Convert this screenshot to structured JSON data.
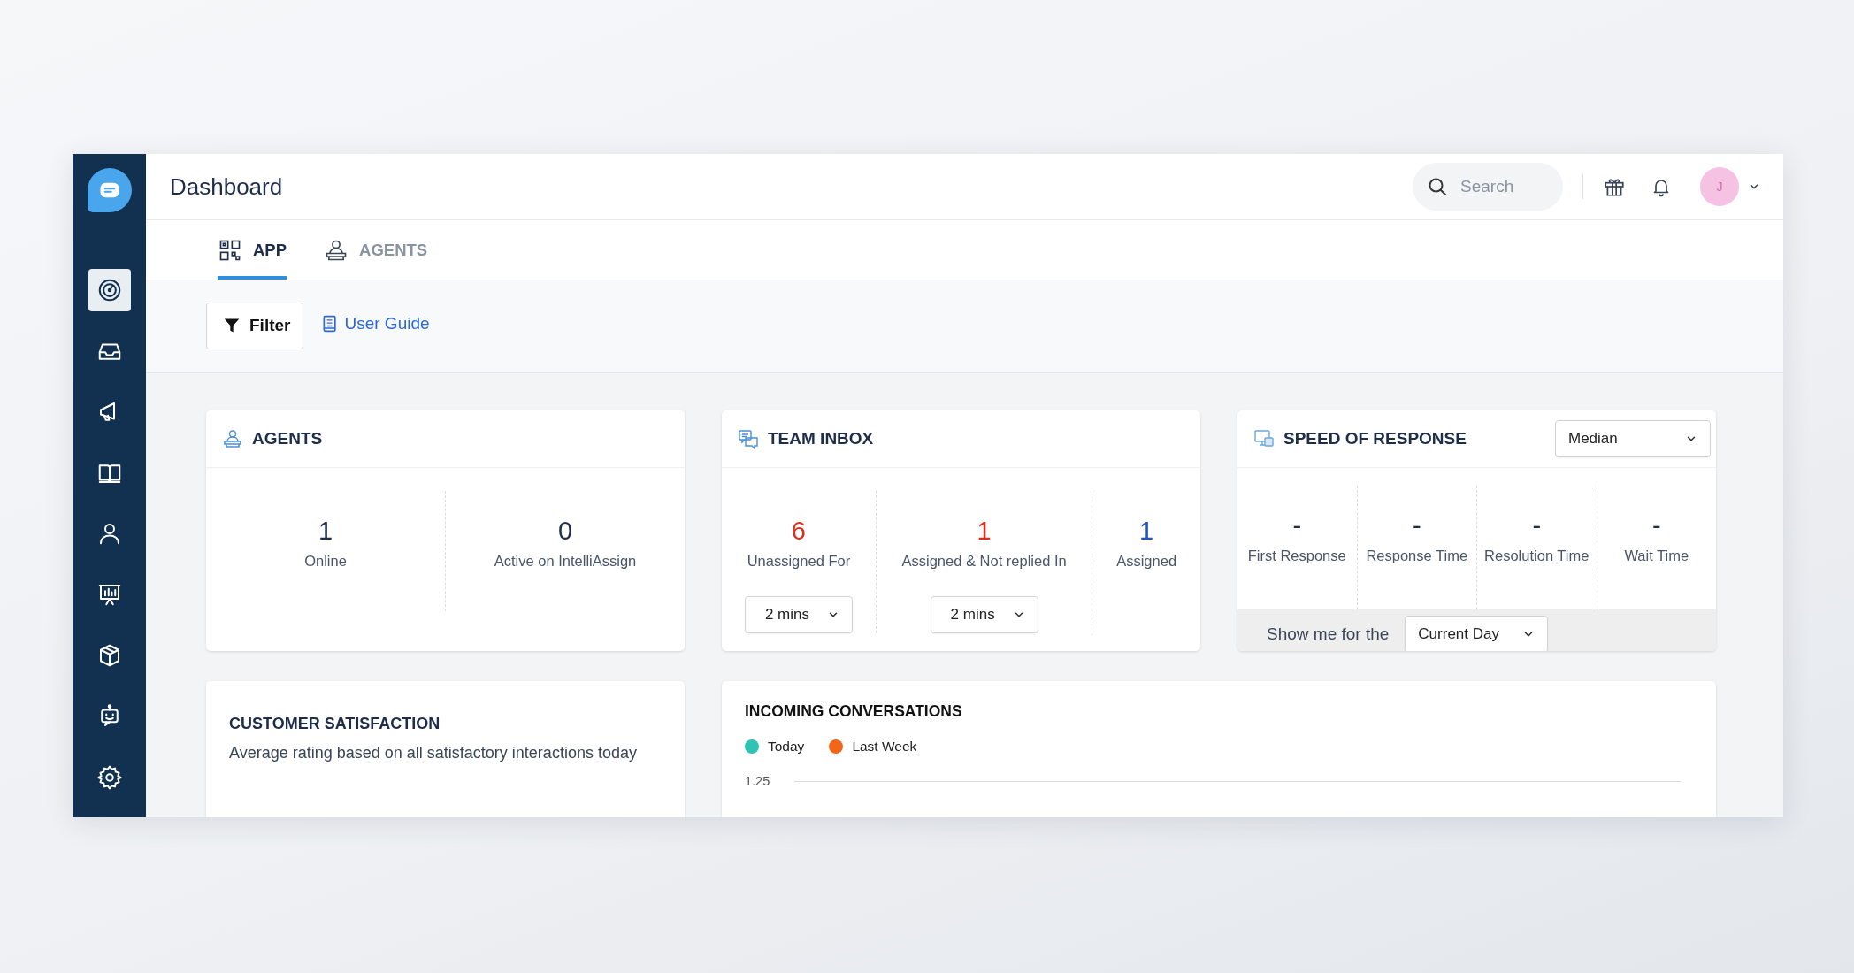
{
  "sidebar": {
    "items": [
      {
        "kind": "dashboard",
        "selected": true
      },
      {
        "kind": "inbox",
        "selected": false
      },
      {
        "kind": "campaigns",
        "selected": false
      },
      {
        "kind": "knowledge",
        "selected": false
      },
      {
        "kind": "contacts",
        "selected": false
      },
      {
        "kind": "reports",
        "selected": false
      },
      {
        "kind": "apps",
        "selected": false
      },
      {
        "kind": "bots",
        "selected": false
      },
      {
        "kind": "settings",
        "selected": false
      }
    ]
  },
  "header": {
    "title": "Dashboard",
    "search": {
      "placeholder": "Search"
    },
    "avatar": "J"
  },
  "tabs": [
    {
      "label": "APP",
      "kind": "app",
      "selected": true
    },
    {
      "label": "AGENTS",
      "kind": "agents",
      "selected": false
    }
  ],
  "toolbar": {
    "filter_button": "Filter",
    "user_guide_link": "User Guide"
  },
  "agents_card": {
    "title": "AGENTS",
    "stats": [
      {
        "value": "1",
        "label": "Online"
      },
      {
        "value": "0",
        "label": "Active on IntelliAssign"
      }
    ]
  },
  "team_inbox": {
    "title": "TEAM INBOX",
    "stats": [
      {
        "value": "6",
        "label": "Unassigned For",
        "color": "#d8301c",
        "dropdown": "2 mins"
      },
      {
        "value": "1",
        "label": "Assigned & Not replied In",
        "color": "#d8301c",
        "dropdown": "2 mins"
      },
      {
        "value": "1",
        "label": "Assigned",
        "color": "#1f56c4"
      }
    ]
  },
  "speed_of_response": {
    "title": "SPEED OF RESPONSE",
    "metric_select": "Median",
    "stats": [
      {
        "value": "-",
        "label": "First Response"
      },
      {
        "value": "-",
        "label": "Response Time"
      },
      {
        "value": "-",
        "label": "Resolution Time"
      },
      {
        "value": "-",
        "label": "Wait Time"
      }
    ],
    "period_label": "Show me for the",
    "period_select": "Current Day"
  },
  "customer_satisfaction": {
    "title": "CUSTOMER SATISFACTION",
    "description": "Average rating based on all satisfactory interactions today"
  },
  "incoming_conversations": {
    "title": "INCOMING CONVERSATIONS",
    "legend": [
      {
        "label": "Today",
        "color": "#2fc3b3"
      },
      {
        "label": "Last Week",
        "color": "#f2661a"
      }
    ],
    "y_tick": "1.25"
  }
}
